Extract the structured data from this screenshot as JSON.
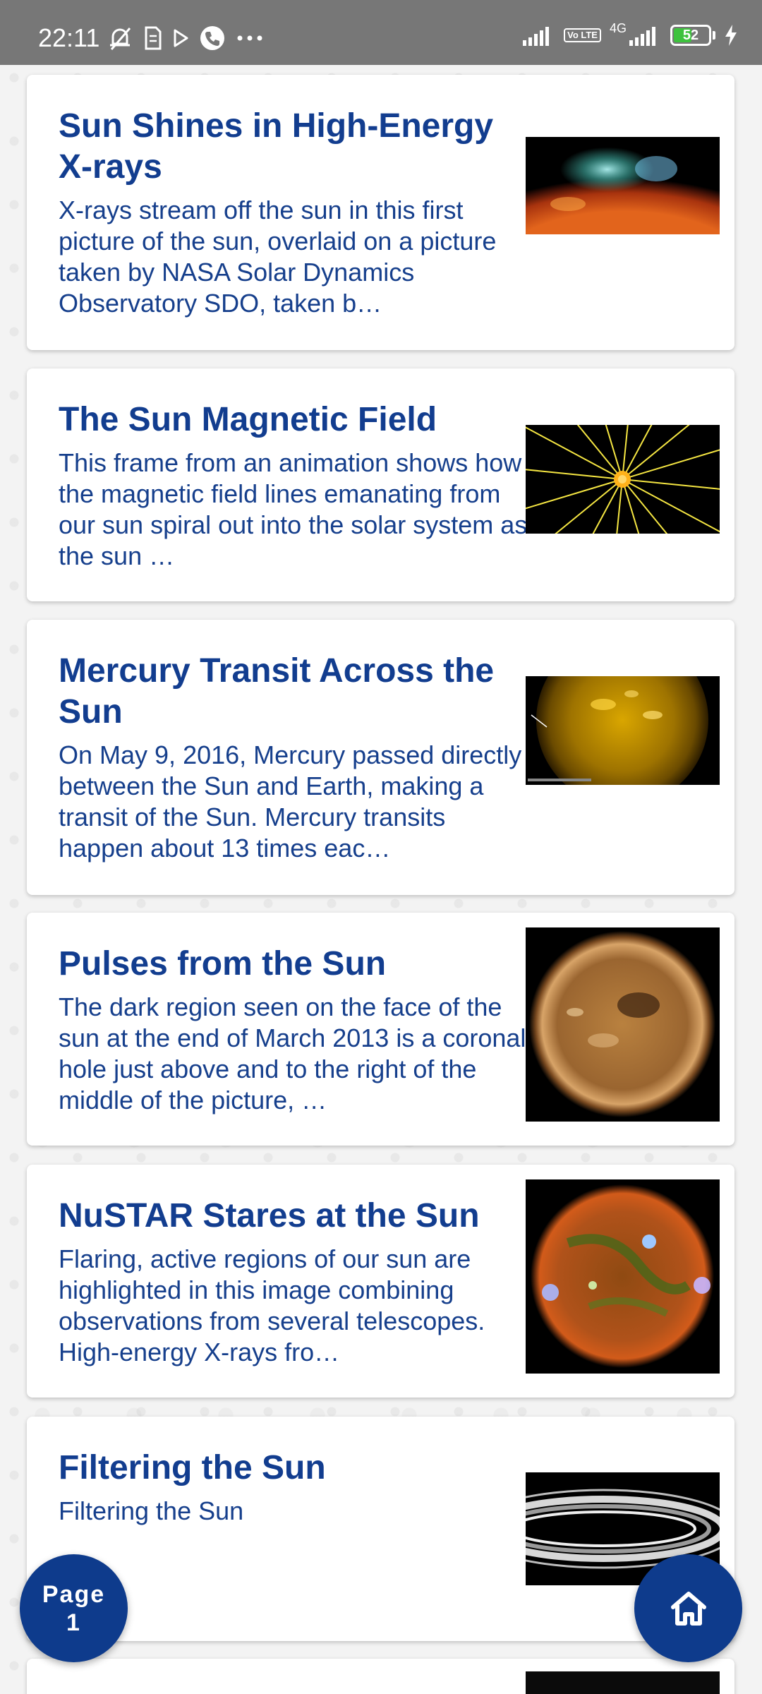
{
  "status_bar": {
    "time": "22:11",
    "network": "4G",
    "volte": "Vo LTE",
    "battery_level": "52",
    "battery_fraction": 0.52,
    "icons": [
      "mute-icon",
      "sim-card-icon",
      "play-store-icon",
      "phone-call-icon",
      "more-dots-icon",
      "signal-icon",
      "charging-icon"
    ]
  },
  "articles": [
    {
      "title": "Sun Shines in High-Energy X-rays",
      "description": "X-rays stream off the sun in this first picture of the sun, overlaid on a picture taken by NASA Solar Dynamics Observatory SDO, taken b…"
    },
    {
      "title": "The Sun Magnetic Field",
      "description": "This frame from an animation shows how the magnetic field lines emanating from our sun spiral out into the solar system as the sun …"
    },
    {
      "title": "Mercury Transit Across the Sun",
      "description": "On May 9, 2016, Mercury passed directly between the Sun and Earth, making a transit of the Sun. Mercury transits happen about 13 times eac…"
    },
    {
      "title": "Pulses from the Sun",
      "description": "The dark region seen on the face of the sun at the end of March 2013 is a coronal hole just above and to the right of the middle of the picture, …"
    },
    {
      "title": "NuSTAR Stares at the Sun",
      "description": "Flaring, active regions of our sun are highlighted in this image combining observations from several telescopes. High-energy X-rays fro…"
    },
    {
      "title": "Filtering the Sun",
      "description": "Filtering the Sun"
    }
  ],
  "page_button": {
    "line1": "Page",
    "line2": "1"
  },
  "colors": {
    "accent": "#0e3b8c",
    "title": "#123d8f",
    "status_bar": "#777777"
  }
}
